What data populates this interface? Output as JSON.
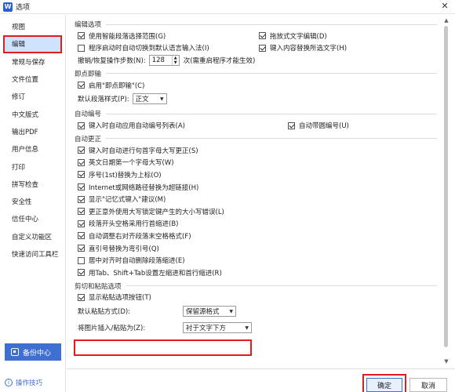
{
  "window": {
    "title": "选项",
    "app_logo_letter": "W",
    "close_symbol": "✕"
  },
  "sidebar": {
    "items": [
      {
        "label": "视图",
        "active": false
      },
      {
        "label": "编辑",
        "active": true
      },
      {
        "label": "常规与保存",
        "active": false
      },
      {
        "label": "文件位置",
        "active": false
      },
      {
        "label": "修订",
        "active": false
      },
      {
        "label": "中文版式",
        "active": false
      },
      {
        "label": "输出PDF",
        "active": false
      },
      {
        "label": "用户信息",
        "active": false
      },
      {
        "label": "打印",
        "active": false
      },
      {
        "label": "拼写检查",
        "active": false
      },
      {
        "label": "安全性",
        "active": false
      },
      {
        "label": "信任中心",
        "active": false
      },
      {
        "label": "自定义功能区",
        "active": false
      },
      {
        "label": "快速访问工具栏",
        "active": false
      }
    ],
    "backup_label": "备份中心",
    "tips_label": "操作技巧"
  },
  "sections": {
    "edit": {
      "title": "编辑选项",
      "smart_select": {
        "label": "使用智能段落选择范围(G)",
        "checked": true
      },
      "drag_edit": {
        "label": "拖放式文字编辑(D)",
        "checked": true
      },
      "auto_ime": {
        "label": "程序启动时自动切换到默认语言输入法(I)",
        "checked": false
      },
      "enter_replace": {
        "label": "键入内容替换所选文字(H)",
        "checked": true
      },
      "undo_label": "撤销/恢复操作步数(N):",
      "undo_value": "128",
      "undo_hint": "次(需重启程序才能生效)"
    },
    "click_type": {
      "title": "即点即输",
      "enable": {
        "label": "启用\"即点即输\"(C)",
        "checked": true
      },
      "default_style_label": "默认段落样式(P):",
      "default_style_value": "正文"
    },
    "auto_number": {
      "title": "自动编号",
      "auto_list": {
        "label": "键入时自动应用自动编号列表(A)",
        "checked": true
      },
      "bracket_number": {
        "label": "自动带圆编号(U)",
        "checked": true
      }
    },
    "autocorrect": {
      "title": "自动更正",
      "items": [
        {
          "label": "键入时自动进行句首字母大写更正(S)",
          "checked": true
        },
        {
          "label": "英文日期第一个字母大写(W)",
          "checked": true
        },
        {
          "label": "序号(1st)替换为上标(O)",
          "checked": true
        },
        {
          "label": "Internet或网络路径替换为超链接(H)",
          "checked": true
        },
        {
          "label": "显示\"记忆式键入\"建议(M)",
          "checked": true
        },
        {
          "label": "更正意外使用大写锁定键产生的大小写错误(L)",
          "checked": true
        },
        {
          "label": "段落开头空格采用行首缩进(B)",
          "checked": true
        },
        {
          "label": "自动调整右对齐段落末空格格式(F)",
          "checked": true
        },
        {
          "label": "直引号替换为弯引号(Q)",
          "checked": true
        },
        {
          "label": "居中对齐时自动删除段落缩进(E)",
          "checked": false
        },
        {
          "label": "用Tab、Shift+Tab设置左缩进和首行缩进(R)",
          "checked": true
        }
      ]
    },
    "paste": {
      "title": "剪切和粘贴选项",
      "show_paste_btn": {
        "label": "显示粘贴选项按钮(T)",
        "checked": true
      },
      "default_paste_label": "默认粘贴方式(D):",
      "default_paste_value": "保留源格式",
      "image_insert_label": "将图片插入/粘贴为(Z):",
      "image_insert_value": "衬于文字下方"
    }
  },
  "buttons": {
    "ok": "确定",
    "cancel": "取消"
  }
}
